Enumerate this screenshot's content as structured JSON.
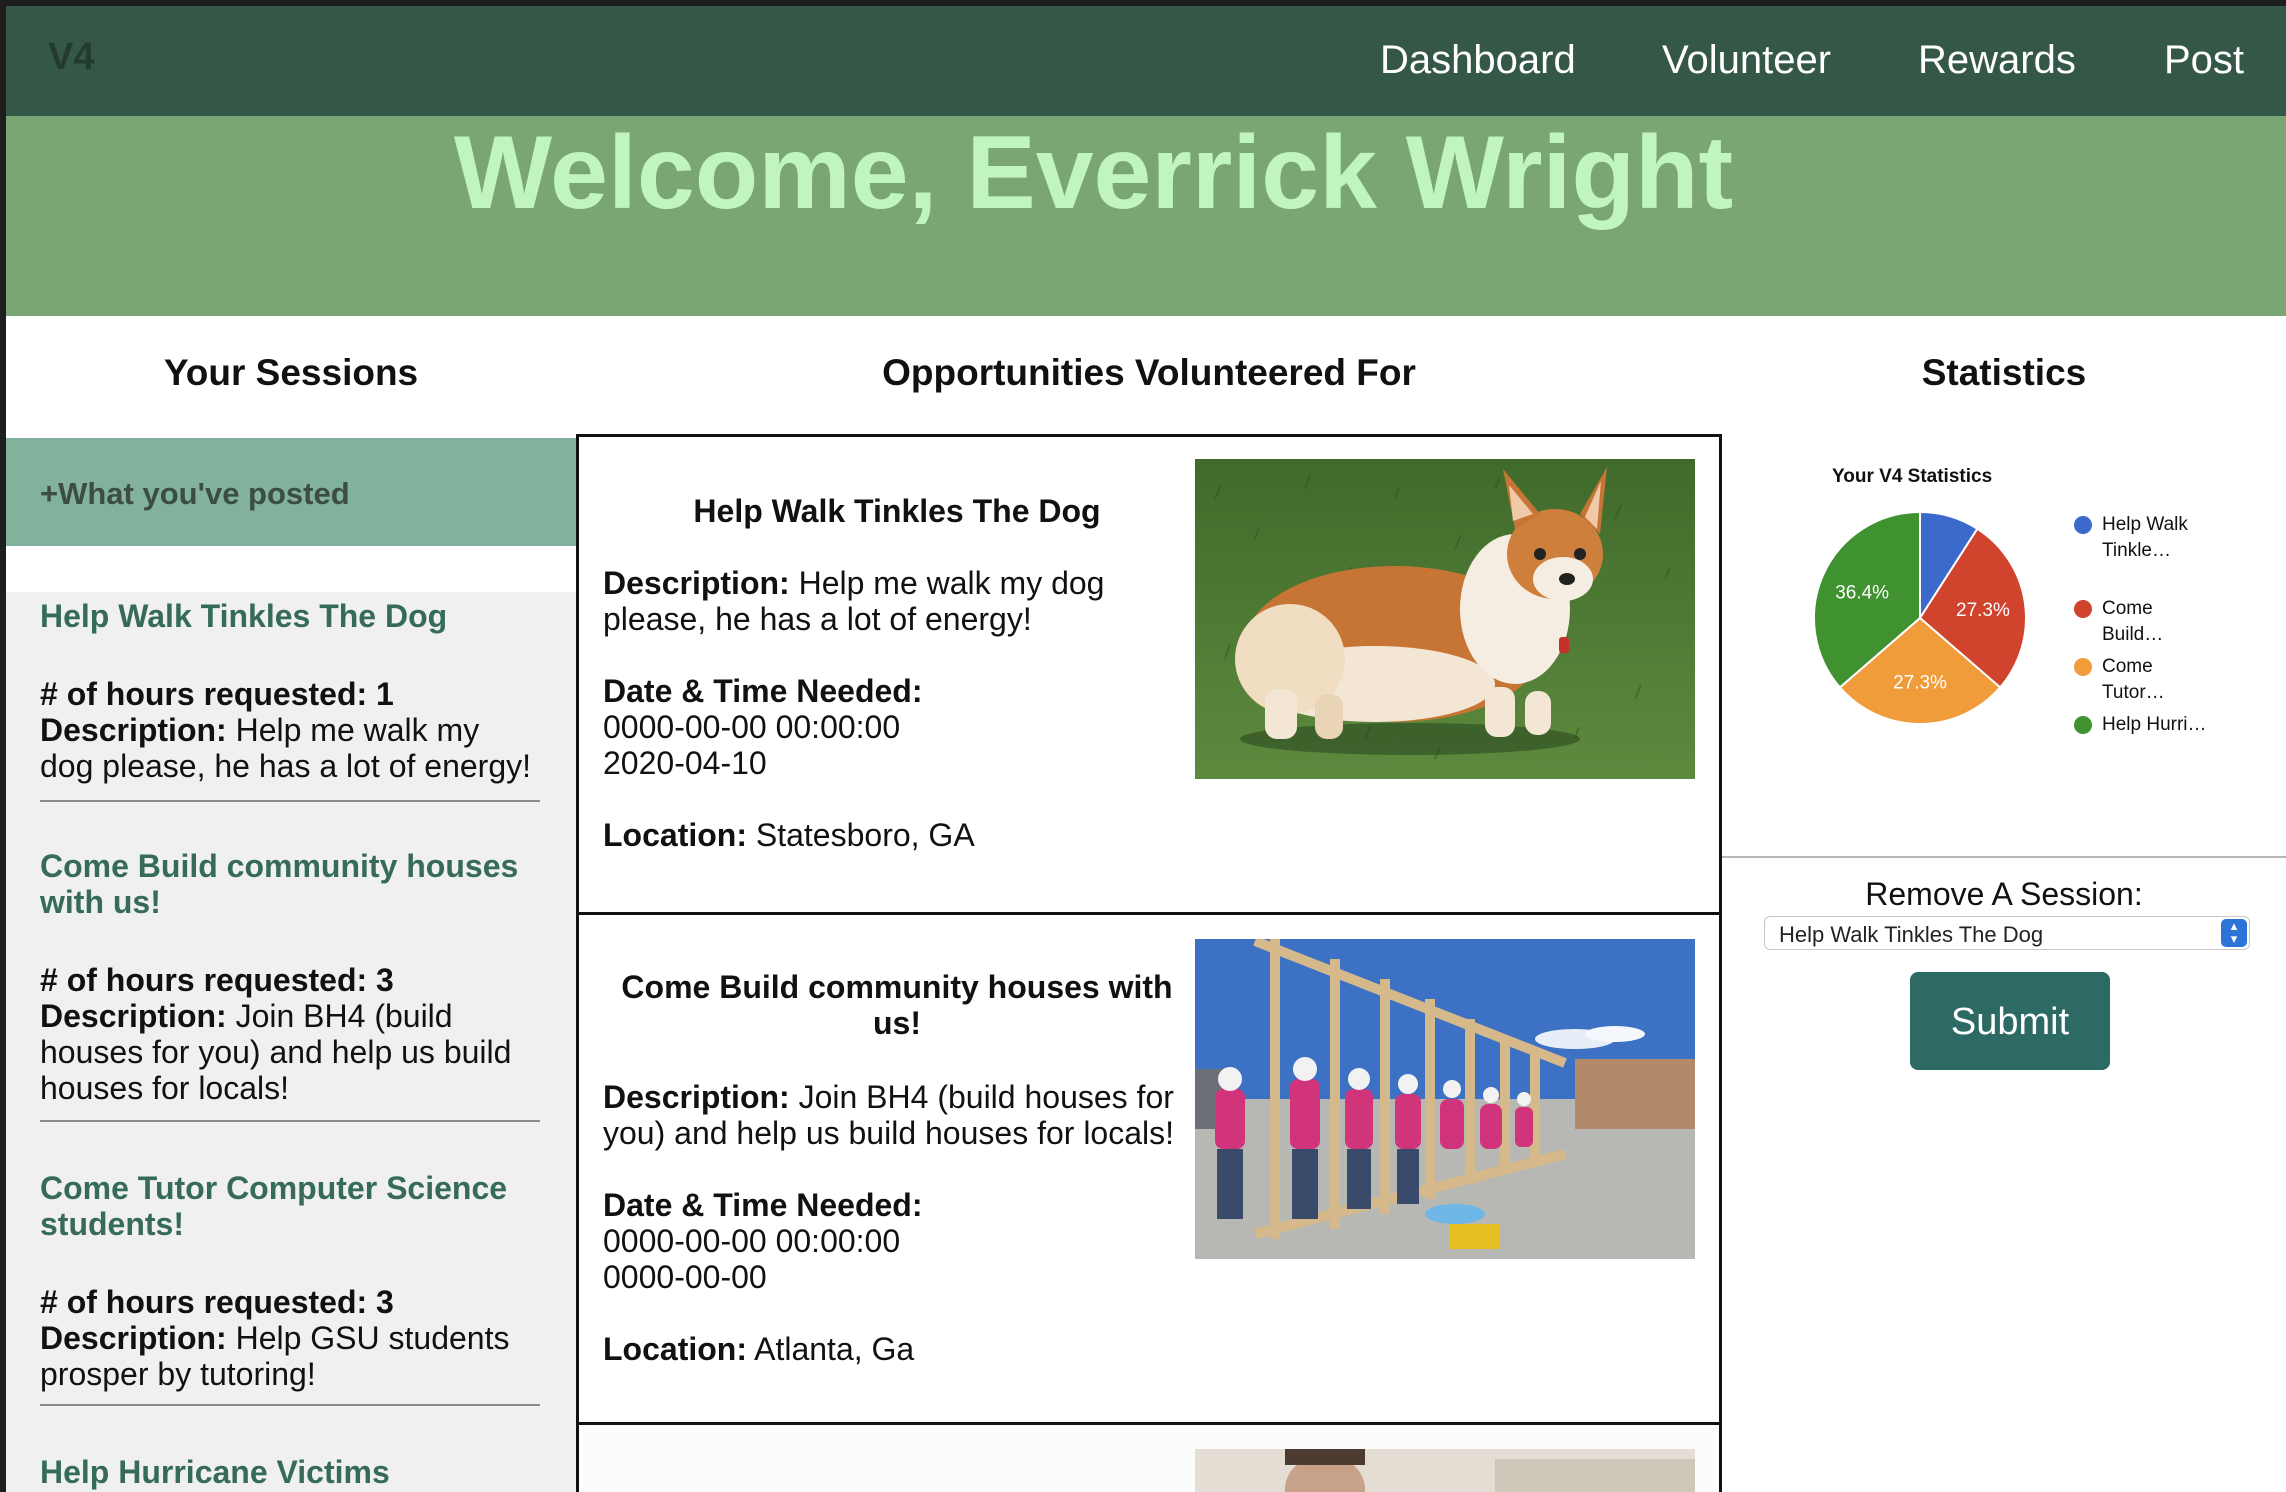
{
  "nav": {
    "brand": "V4",
    "links": [
      "Dashboard",
      "Volunteer",
      "Rewards",
      "Post"
    ]
  },
  "hero": {
    "title": "Welcome, Everrick Wright"
  },
  "columns": {
    "sessions": "Your Sessions",
    "opportunities": "Opportunities Volunteered For",
    "statistics": "Statistics"
  },
  "sessions": {
    "posted_label": "+What you've posted",
    "hours_label": "# of hours requested:",
    "description_label": "Description:",
    "items": [
      {
        "title": "Help Walk Tinkles The Dog",
        "hours": "1",
        "description": "Help me walk my dog please, he has a lot of energy!"
      },
      {
        "title": "Come Build community houses with us!",
        "hours": "3",
        "description": "Join BH4 (build houses for you) and help us build houses for locals!"
      },
      {
        "title": "Come Tutor Computer Science students!",
        "hours": "3",
        "description": "Help GSU students prosper by tutoring!"
      },
      {
        "title": "Help Hurricane Victims",
        "hours": "",
        "description": ""
      }
    ]
  },
  "opportunities": {
    "description_label": "Description:",
    "datetime_label": "Date & Time Needed:",
    "location_label": "Location:",
    "items": [
      {
        "title": "Help Walk Tinkles The Dog",
        "description": "Help me walk my dog please, he has a lot of energy!",
        "datetime": "0000-00-00 00:00:00",
        "date": "2020-04-10",
        "location": "Statesboro, GA",
        "image": "corgi-photo"
      },
      {
        "title": "Come Build community houses with us!",
        "description": "Join BH4 (build houses for you) and help us build houses for locals!",
        "datetime": "0000-00-00 00:00:00",
        "date": "0000-00-00",
        "location": "Atlanta, Ga",
        "image": "house-building-photo"
      }
    ]
  },
  "chart_data": {
    "type": "pie",
    "title": "Your V4 Statistics",
    "legend_position": "right",
    "slices": [
      {
        "label": "Help Walk Tinkle…",
        "value": 9.1,
        "color": "#3c6acc",
        "show_label": false
      },
      {
        "label": "Come Build…",
        "value": 27.3,
        "color": "#d0432c",
        "show_label": true
      },
      {
        "label": "Come Tutor…",
        "value": 27.3,
        "color": "#f09c3a",
        "show_label": true
      },
      {
        "label": "Help Hurri…",
        "value": 36.4,
        "color": "#3f922f",
        "show_label": true
      }
    ]
  },
  "remove": {
    "label": "Remove A Session:",
    "selected": "Help Walk Tinkles The Dog",
    "submit": "Submit"
  }
}
